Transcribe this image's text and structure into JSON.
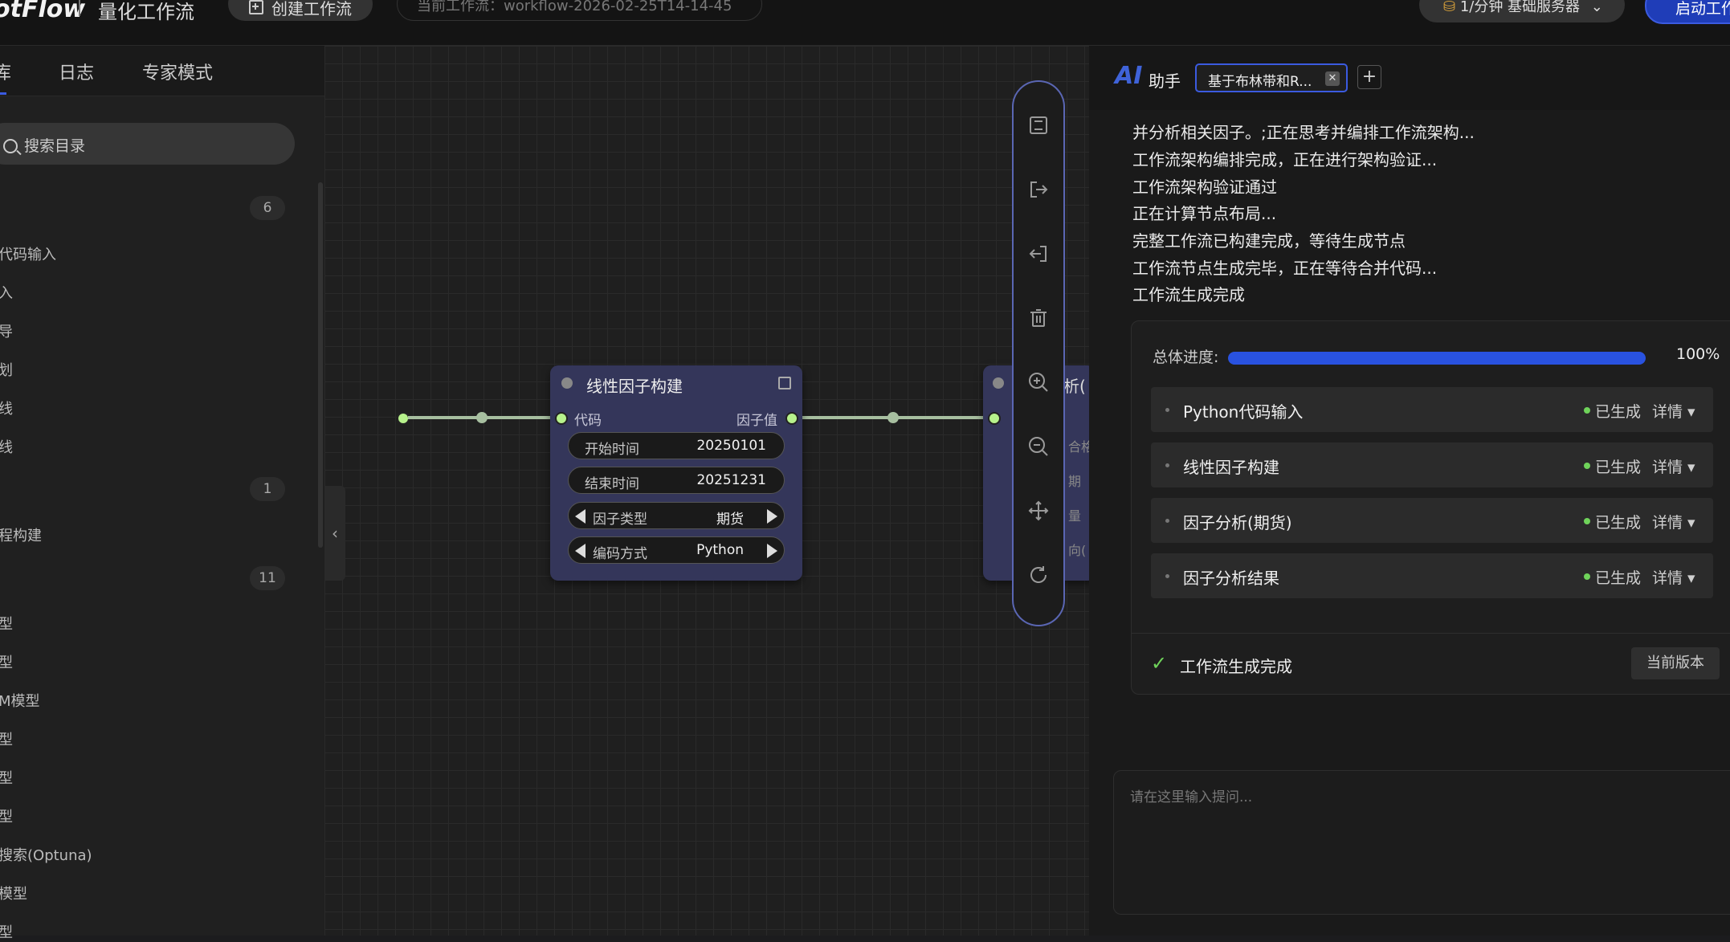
{
  "topbar": {
    "brand": "otFlow",
    "subtitle": "量化工作流",
    "create_button": "创建工作流",
    "current_workflow": "当前工作流：workflow-2026-02-25T14-14-45",
    "server_label": "1/分钟  基础服务器",
    "launch_button": "启动工作"
  },
  "left_panel": {
    "tabs": [
      "库",
      "日志",
      "专家模式"
    ],
    "search_placeholder": "搜索目录",
    "groups": [
      {
        "count": "6",
        "items": [
          "代码输入",
          "入",
          "导",
          "划",
          "线",
          "线"
        ]
      },
      {
        "count": "1",
        "items": [
          "程构建"
        ]
      },
      {
        "count": "11",
        "items": [
          "型",
          "型",
          "M模型",
          "型",
          "型",
          "型",
          "搜索(Optuna)",
          "模型",
          "型"
        ]
      }
    ]
  },
  "canvas": {
    "node_left": {
      "output_label": "代码"
    },
    "node_main": {
      "title": "线性因子构建",
      "input_label": "代码",
      "output_label": "因子值",
      "fields": [
        {
          "key": "开始时间",
          "value": "20250101"
        },
        {
          "key": "结束时间",
          "value": "20251231"
        },
        {
          "key": "因子类型",
          "value": "期货"
        },
        {
          "key": "编码方式",
          "value": "Python"
        }
      ]
    },
    "node_right": {
      "title": "析(",
      "rows": [
        "合格",
        "期",
        "量",
        "向("
      ]
    },
    "toolbar_icons": [
      "save-icon",
      "export-icon",
      "import-icon",
      "delete-icon",
      "zoom-in-icon",
      "zoom-out-icon",
      "move-icon",
      "refresh-icon"
    ]
  },
  "ai": {
    "logo": "AI",
    "title": "助手",
    "tab_label": "基于布林带和R...",
    "log": [
      "并分析相关因子。;正在思考并编排工作流架构...",
      "工作流架构编排完成，正在进行架构验证...",
      "工作流架构验证通过",
      "正在计算节点布局...",
      "完整工作流已构建完成，等待生成节点",
      "工作流节点生成完毕，正在等待合并代码...",
      "工作流生成完成"
    ],
    "progress_label": "总体进度:",
    "progress_value": 100,
    "progress_text": "100%",
    "steps": [
      {
        "name": "Python代码输入",
        "status": "已生成",
        "details": "详情 ▾"
      },
      {
        "name": "线性因子构建",
        "status": "已生成",
        "details": "详情 ▾"
      },
      {
        "name": "因子分析(期货)",
        "status": "已生成",
        "details": "详情 ▾"
      },
      {
        "name": "因子分析结果",
        "status": "已生成",
        "details": "详情 ▾"
      }
    ],
    "done_text": "工作流生成完成",
    "version_button": "当前版本",
    "input_placeholder": "请在这里输入提问..."
  }
}
